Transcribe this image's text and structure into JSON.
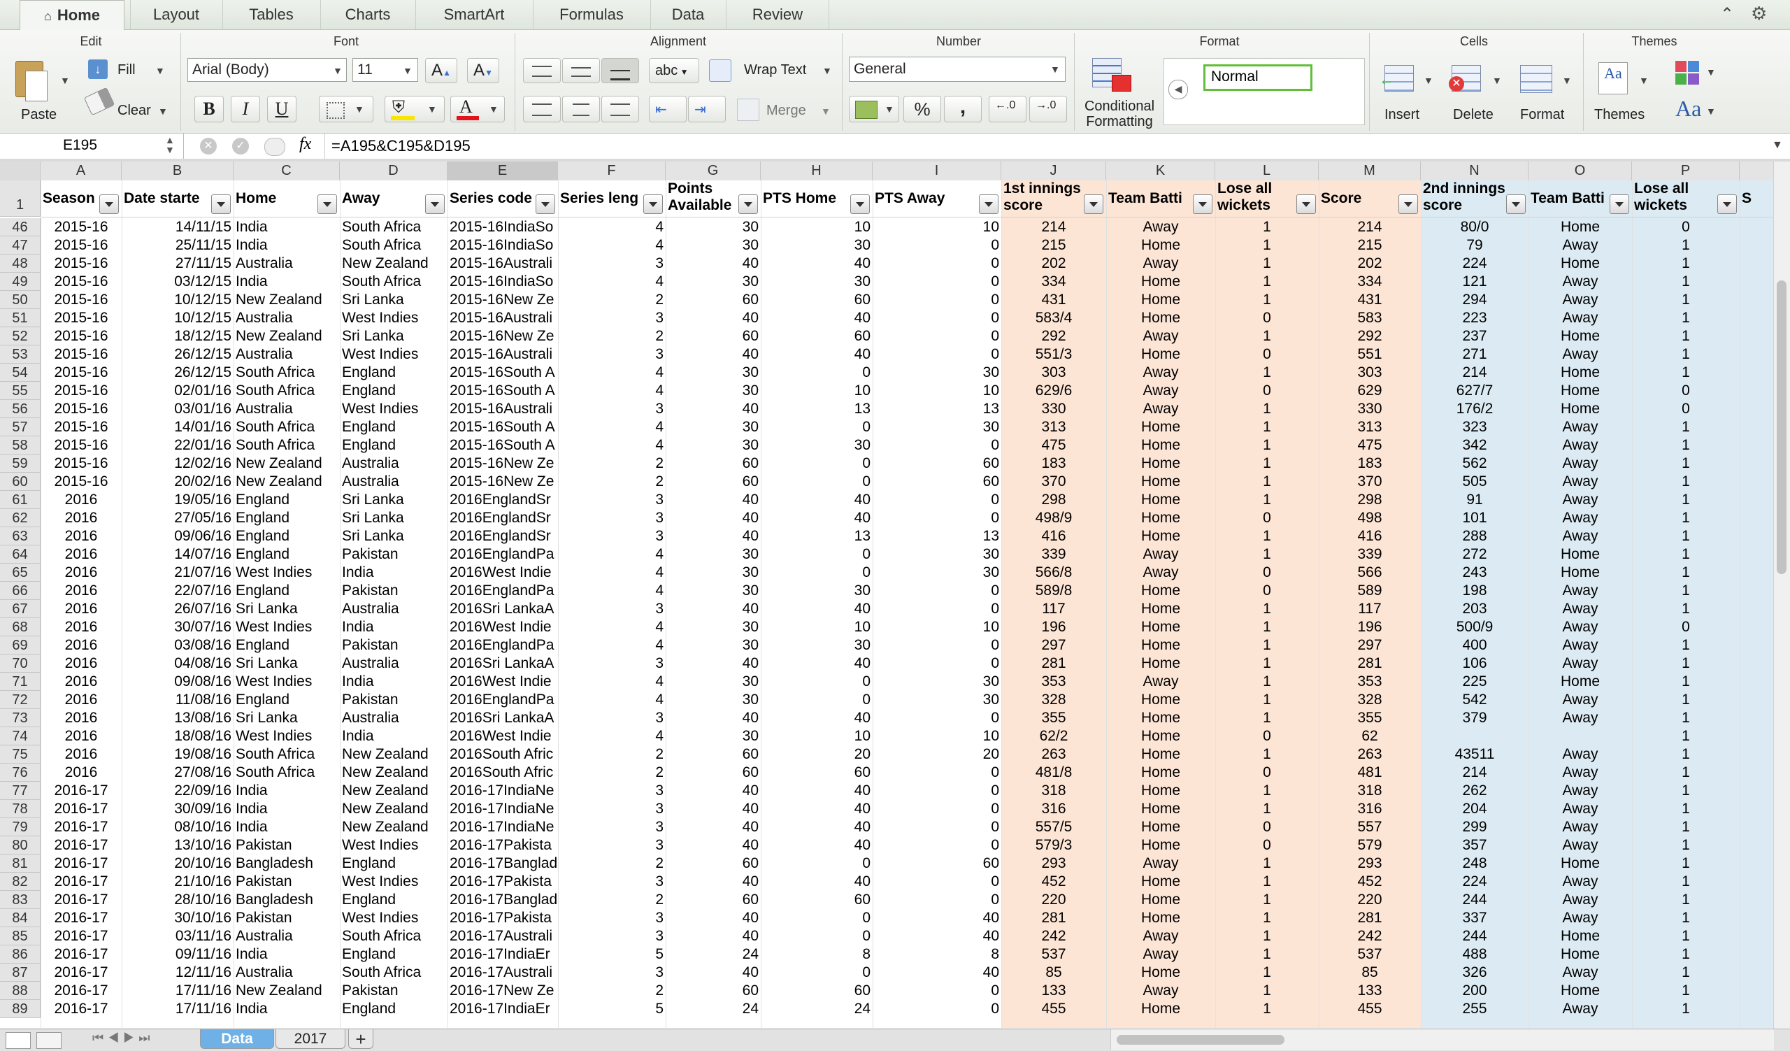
{
  "ribbon_tabs": [
    "Home",
    "Layout",
    "Tables",
    "Charts",
    "SmartArt",
    "Formulas",
    "Data",
    "Review"
  ],
  "ribbon": {
    "edit": {
      "title": "Edit",
      "paste": "Paste",
      "fill": "Fill",
      "clear": "Clear"
    },
    "font": {
      "title": "Font",
      "name": "Arial (Body)",
      "size": "11",
      "bold": "B",
      "italic": "I",
      "underline": "U",
      "grow": "A",
      "shrink": "A"
    },
    "alignment": {
      "title": "Alignment",
      "wrap": "Wrap Text",
      "merge": "Merge",
      "abc": "abc"
    },
    "number": {
      "title": "Number",
      "format": "General",
      "percent": "%",
      "comma": ","
    },
    "format": {
      "title": "Format",
      "conditional_line1": "Conditional",
      "conditional_line2": "Formatting",
      "style": "Normal"
    },
    "cells": {
      "title": "Cells",
      "insert": "Insert",
      "delete": "Delete",
      "format": "Format"
    },
    "themes": {
      "title": "Themes",
      "themes": "Themes"
    }
  },
  "formula_bar": {
    "name_box": "E195",
    "fx": "fx",
    "formula": "=A195&C195&D195"
  },
  "columns": [
    "A",
    "B",
    "C",
    "D",
    "E",
    "F",
    "G",
    "H",
    "I",
    "J",
    "K",
    "L",
    "M",
    "N",
    "O",
    "P"
  ],
  "selected_column": "E",
  "headers": [
    {
      "l1": "Season"
    },
    {
      "l1": "Date starte"
    },
    {
      "l1": "Home"
    },
    {
      "l1": "Away"
    },
    {
      "l1": "Series code"
    },
    {
      "l1": "Series leng"
    },
    {
      "l1": "Points",
      "l2": "Available"
    },
    {
      "l1": "PTS Home"
    },
    {
      "l1": "PTS Away"
    },
    {
      "l1": "1st innings",
      "l2": "score"
    },
    {
      "l1": "Team Batti"
    },
    {
      "l1": "Lose all",
      "l2": "wickets"
    },
    {
      "l1": "Score"
    },
    {
      "l1": "2nd innings",
      "l2": "score"
    },
    {
      "l1": "Team Batti"
    },
    {
      "l1": "Lose all",
      "l2": "wickets"
    },
    {
      "l1": "Sco"
    }
  ],
  "header_row_number": "1",
  "rows": [
    [
      "46",
      "2015-16",
      "14/11/15",
      "India",
      "South Africa",
      "2015-16IndiaSo",
      "4",
      "30",
      "10",
      "10",
      "214",
      "Away",
      "1",
      "214",
      "80/0",
      "Home",
      "0"
    ],
    [
      "47",
      "2015-16",
      "25/11/15",
      "India",
      "South Africa",
      "2015-16IndiaSo",
      "4",
      "30",
      "30",
      "0",
      "215",
      "Home",
      "1",
      "215",
      "79",
      "Away",
      "1"
    ],
    [
      "48",
      "2015-16",
      "27/11/15",
      "Australia",
      "New Zealand",
      "2015-16Australi",
      "3",
      "40",
      "40",
      "0",
      "202",
      "Away",
      "1",
      "202",
      "224",
      "Home",
      "1"
    ],
    [
      "49",
      "2015-16",
      "03/12/15",
      "India",
      "South Africa",
      "2015-16IndiaSo",
      "4",
      "30",
      "30",
      "0",
      "334",
      "Home",
      "1",
      "334",
      "121",
      "Away",
      "1"
    ],
    [
      "50",
      "2015-16",
      "10/12/15",
      "New Zealand",
      "Sri Lanka",
      "2015-16New Ze",
      "2",
      "60",
      "60",
      "0",
      "431",
      "Home",
      "1",
      "431",
      "294",
      "Away",
      "1"
    ],
    [
      "51",
      "2015-16",
      "10/12/15",
      "Australia",
      "West Indies",
      "2015-16Australi",
      "3",
      "40",
      "40",
      "0",
      "583/4",
      "Home",
      "0",
      "583",
      "223",
      "Away",
      "1"
    ],
    [
      "52",
      "2015-16",
      "18/12/15",
      "New Zealand",
      "Sri Lanka",
      "2015-16New Ze",
      "2",
      "60",
      "60",
      "0",
      "292",
      "Away",
      "1",
      "292",
      "237",
      "Home",
      "1"
    ],
    [
      "53",
      "2015-16",
      "26/12/15",
      "Australia",
      "West Indies",
      "2015-16Australi",
      "3",
      "40",
      "40",
      "0",
      "551/3",
      "Home",
      "0",
      "551",
      "271",
      "Away",
      "1"
    ],
    [
      "54",
      "2015-16",
      "26/12/15",
      "South Africa",
      "England",
      "2015-16South A",
      "4",
      "30",
      "0",
      "30",
      "303",
      "Away",
      "1",
      "303",
      "214",
      "Home",
      "1"
    ],
    [
      "55",
      "2015-16",
      "02/01/16",
      "South Africa",
      "England",
      "2015-16South A",
      "4",
      "30",
      "10",
      "10",
      "629/6",
      "Away",
      "0",
      "629",
      "627/7",
      "Home",
      "0"
    ],
    [
      "56",
      "2015-16",
      "03/01/16",
      "Australia",
      "West Indies",
      "2015-16Australi",
      "3",
      "40",
      "13",
      "13",
      "330",
      "Away",
      "1",
      "330",
      "176/2",
      "Home",
      "0"
    ],
    [
      "57",
      "2015-16",
      "14/01/16",
      "South Africa",
      "England",
      "2015-16South A",
      "4",
      "30",
      "0",
      "30",
      "313",
      "Home",
      "1",
      "313",
      "323",
      "Away",
      "1"
    ],
    [
      "58",
      "2015-16",
      "22/01/16",
      "South Africa",
      "England",
      "2015-16South A",
      "4",
      "30",
      "30",
      "0",
      "475",
      "Home",
      "1",
      "475",
      "342",
      "Away",
      "1"
    ],
    [
      "59",
      "2015-16",
      "12/02/16",
      "New Zealand",
      "Australia",
      "2015-16New Ze",
      "2",
      "60",
      "0",
      "60",
      "183",
      "Home",
      "1",
      "183",
      "562",
      "Away",
      "1"
    ],
    [
      "60",
      "2015-16",
      "20/02/16",
      "New Zealand",
      "Australia",
      "2015-16New Ze",
      "2",
      "60",
      "0",
      "60",
      "370",
      "Home",
      "1",
      "370",
      "505",
      "Away",
      "1"
    ],
    [
      "61",
      "2016",
      "19/05/16",
      "England",
      "Sri Lanka",
      "2016EnglandSr",
      "3",
      "40",
      "40",
      "0",
      "298",
      "Home",
      "1",
      "298",
      "91",
      "Away",
      "1"
    ],
    [
      "62",
      "2016",
      "27/05/16",
      "England",
      "Sri Lanka",
      "2016EnglandSr",
      "3",
      "40",
      "40",
      "0",
      "498/9",
      "Home",
      "0",
      "498",
      "101",
      "Away",
      "1"
    ],
    [
      "63",
      "2016",
      "09/06/16",
      "England",
      "Sri Lanka",
      "2016EnglandSr",
      "3",
      "40",
      "13",
      "13",
      "416",
      "Home",
      "1",
      "416",
      "288",
      "Away",
      "1"
    ],
    [
      "64",
      "2016",
      "14/07/16",
      "England",
      "Pakistan",
      "2016EnglandPa",
      "4",
      "30",
      "0",
      "30",
      "339",
      "Away",
      "1",
      "339",
      "272",
      "Home",
      "1"
    ],
    [
      "65",
      "2016",
      "21/07/16",
      "West Indies",
      "India",
      "2016West Indie",
      "4",
      "30",
      "0",
      "30",
      "566/8",
      "Away",
      "0",
      "566",
      "243",
      "Home",
      "1"
    ],
    [
      "66",
      "2016",
      "22/07/16",
      "England",
      "Pakistan",
      "2016EnglandPa",
      "4",
      "30",
      "30",
      "0",
      "589/8",
      "Home",
      "0",
      "589",
      "198",
      "Away",
      "1"
    ],
    [
      "67",
      "2016",
      "26/07/16",
      "Sri Lanka",
      "Australia",
      "2016Sri LankaA",
      "3",
      "40",
      "40",
      "0",
      "117",
      "Home",
      "1",
      "117",
      "203",
      "Away",
      "1"
    ],
    [
      "68",
      "2016",
      "30/07/16",
      "West Indies",
      "India",
      "2016West Indie",
      "4",
      "30",
      "10",
      "10",
      "196",
      "Home",
      "1",
      "196",
      "500/9",
      "Away",
      "0"
    ],
    [
      "69",
      "2016",
      "03/08/16",
      "England",
      "Pakistan",
      "2016EnglandPa",
      "4",
      "30",
      "30",
      "0",
      "297",
      "Home",
      "1",
      "297",
      "400",
      "Away",
      "1"
    ],
    [
      "70",
      "2016",
      "04/08/16",
      "Sri Lanka",
      "Australia",
      "2016Sri LankaA",
      "3",
      "40",
      "40",
      "0",
      "281",
      "Home",
      "1",
      "281",
      "106",
      "Away",
      "1"
    ],
    [
      "71",
      "2016",
      "09/08/16",
      "West Indies",
      "India",
      "2016West Indie",
      "4",
      "30",
      "0",
      "30",
      "353",
      "Away",
      "1",
      "353",
      "225",
      "Home",
      "1"
    ],
    [
      "72",
      "2016",
      "11/08/16",
      "England",
      "Pakistan",
      "2016EnglandPa",
      "4",
      "30",
      "0",
      "30",
      "328",
      "Home",
      "1",
      "328",
      "542",
      "Away",
      "1"
    ],
    [
      "73",
      "2016",
      "13/08/16",
      "Sri Lanka",
      "Australia",
      "2016Sri LankaA",
      "3",
      "40",
      "40",
      "0",
      "355",
      "Home",
      "1",
      "355",
      "379",
      "Away",
      "1"
    ],
    [
      "74",
      "2016",
      "18/08/16",
      "West Indies",
      "India",
      "2016West Indie",
      "4",
      "30",
      "10",
      "10",
      "62/2",
      "Home",
      "0",
      "62",
      "",
      "",
      "1"
    ],
    [
      "75",
      "2016",
      "19/08/16",
      "South Africa",
      "New Zealand",
      "2016South Afric",
      "2",
      "60",
      "20",
      "20",
      "263",
      "Home",
      "1",
      "263",
      "43511",
      "Away",
      "1"
    ],
    [
      "76",
      "2016",
      "27/08/16",
      "South Africa",
      "New Zealand",
      "2016South Afric",
      "2",
      "60",
      "60",
      "0",
      "481/8",
      "Home",
      "0",
      "481",
      "214",
      "Away",
      "1"
    ],
    [
      "77",
      "2016-17",
      "22/09/16",
      "India",
      "New Zealand",
      "2016-17IndiaNe",
      "3",
      "40",
      "40",
      "0",
      "318",
      "Home",
      "1",
      "318",
      "262",
      "Away",
      "1"
    ],
    [
      "78",
      "2016-17",
      "30/09/16",
      "India",
      "New Zealand",
      "2016-17IndiaNe",
      "3",
      "40",
      "40",
      "0",
      "316",
      "Home",
      "1",
      "316",
      "204",
      "Away",
      "1"
    ],
    [
      "79",
      "2016-17",
      "08/10/16",
      "India",
      "New Zealand",
      "2016-17IndiaNe",
      "3",
      "40",
      "40",
      "0",
      "557/5",
      "Home",
      "0",
      "557",
      "299",
      "Away",
      "1"
    ],
    [
      "80",
      "2016-17",
      "13/10/16",
      "Pakistan",
      "West Indies",
      "2016-17Pakista",
      "3",
      "40",
      "40",
      "0",
      "579/3",
      "Home",
      "0",
      "579",
      "357",
      "Away",
      "1"
    ],
    [
      "81",
      "2016-17",
      "20/10/16",
      "Bangladesh",
      "England",
      "2016-17Banglad",
      "2",
      "60",
      "0",
      "60",
      "293",
      "Away",
      "1",
      "293",
      "248",
      "Home",
      "1"
    ],
    [
      "82",
      "2016-17",
      "21/10/16",
      "Pakistan",
      "West Indies",
      "2016-17Pakista",
      "3",
      "40",
      "40",
      "0",
      "452",
      "Home",
      "1",
      "452",
      "224",
      "Away",
      "1"
    ],
    [
      "83",
      "2016-17",
      "28/10/16",
      "Bangladesh",
      "England",
      "2016-17Banglad",
      "2",
      "60",
      "60",
      "0",
      "220",
      "Home",
      "1",
      "220",
      "244",
      "Away",
      "1"
    ],
    [
      "84",
      "2016-17",
      "30/10/16",
      "Pakistan",
      "West Indies",
      "2016-17Pakista",
      "3",
      "40",
      "0",
      "40",
      "281",
      "Home",
      "1",
      "281",
      "337",
      "Away",
      "1"
    ],
    [
      "85",
      "2016-17",
      "03/11/16",
      "Australia",
      "South Africa",
      "2016-17Australi",
      "3",
      "40",
      "0",
      "40",
      "242",
      "Away",
      "1",
      "242",
      "244",
      "Home",
      "1"
    ],
    [
      "86",
      "2016-17",
      "09/11/16",
      "India",
      "England",
      "2016-17IndiaEr",
      "5",
      "24",
      "8",
      "8",
      "537",
      "Away",
      "1",
      "537",
      "488",
      "Home",
      "1"
    ],
    [
      "87",
      "2016-17",
      "12/11/16",
      "Australia",
      "South Africa",
      "2016-17Australi",
      "3",
      "40",
      "0",
      "40",
      "85",
      "Home",
      "1",
      "85",
      "326",
      "Away",
      "1"
    ],
    [
      "88",
      "2016-17",
      "17/11/16",
      "New Zealand",
      "Pakistan",
      "2016-17New Ze",
      "2",
      "60",
      "60",
      "0",
      "133",
      "Away",
      "1",
      "133",
      "200",
      "Home",
      "1"
    ],
    [
      "89",
      "2016-17",
      "17/11/16",
      "India",
      "England",
      "2016-17IndiaEr",
      "5",
      "24",
      "24",
      "0",
      "455",
      "Home",
      "1",
      "455",
      "255",
      "Away",
      "1"
    ]
  ],
  "sheet_tabs": [
    "Data",
    "2017"
  ],
  "active_sheet": "Data",
  "colors": {
    "orange_fill": "#fde5d6",
    "blue_fill": "#dcebf3",
    "ribbon_bg": "#eef0ec"
  }
}
